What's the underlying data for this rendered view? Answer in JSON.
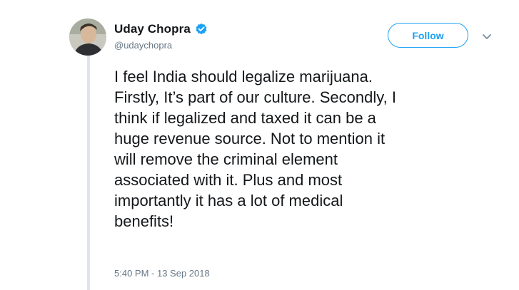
{
  "author": {
    "display_name": "Uday Chopra",
    "handle": "@udaychopra",
    "verified": true
  },
  "actions": {
    "follow_label": "Follow"
  },
  "icons": {
    "verified": "verified-badge-icon",
    "menu": "chevron-down-icon"
  },
  "tweet": {
    "text": "I feel India should legalize marijuana.\nFirstly, It’s part of our culture. Secondly, I\nthink if legalized and taxed it can be a\nhuge revenue source. Not to mention it\nwill remove the criminal element\nassociated with it. Plus and most\nimportantly it has a lot of medical\nbenefits!",
    "timestamp": "5:40 PM - 13 Sep 2018"
  },
  "colors": {
    "accent": "#1da1f2",
    "text": "#14171a",
    "secondary_text": "#657786",
    "thread_line": "#dfe5ea"
  }
}
